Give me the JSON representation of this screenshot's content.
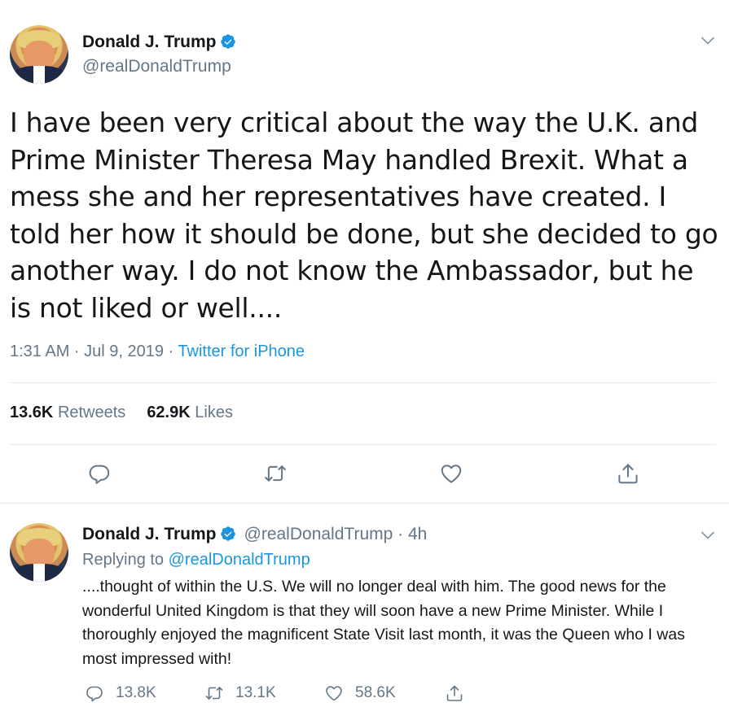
{
  "main_tweet": {
    "author_name": "Donald J. Trump",
    "handle": "@realDonaldTrump",
    "text": "I have been very critical about the way the U.K. and Prime Minister Theresa May handled Brexit. What a mess she and her representatives have created. I told her how it should be done, but she decided to go another way. I do not know the Ambassador, but he is not liked or well....",
    "time": "1:31 AM · Jul 9, 2019 · ",
    "source": "Twitter for iPhone",
    "retweets_count": "13.6K",
    "retweets_label": "Retweets",
    "likes_count": "62.9K",
    "likes_label": "Likes"
  },
  "reply_tweet": {
    "author_name": "Donald J. Trump",
    "handle_time": "@realDonaldTrump · 4h",
    "replying_to_label": "Replying to ",
    "replying_to_handle": "@realDonaldTrump",
    "text": "....thought of within the U.S. We will no longer deal with him. The good news for the wonderful United Kingdom is that they will soon have a new Prime Minister. While I thoroughly enjoyed the magnificent State Visit last month, it was the Queen who I was most impressed with!",
    "replies_count": "13.8K",
    "retweets_count": "13.1K",
    "likes_count": "58.6K"
  },
  "colors": {
    "accent": "#1b95e0",
    "muted": "#657786",
    "text": "#14171a",
    "divider": "#e6ecf0"
  },
  "icons": [
    "verified-badge-icon",
    "chevron-down-icon",
    "reply-icon",
    "retweet-icon",
    "like-icon",
    "share-icon"
  ]
}
